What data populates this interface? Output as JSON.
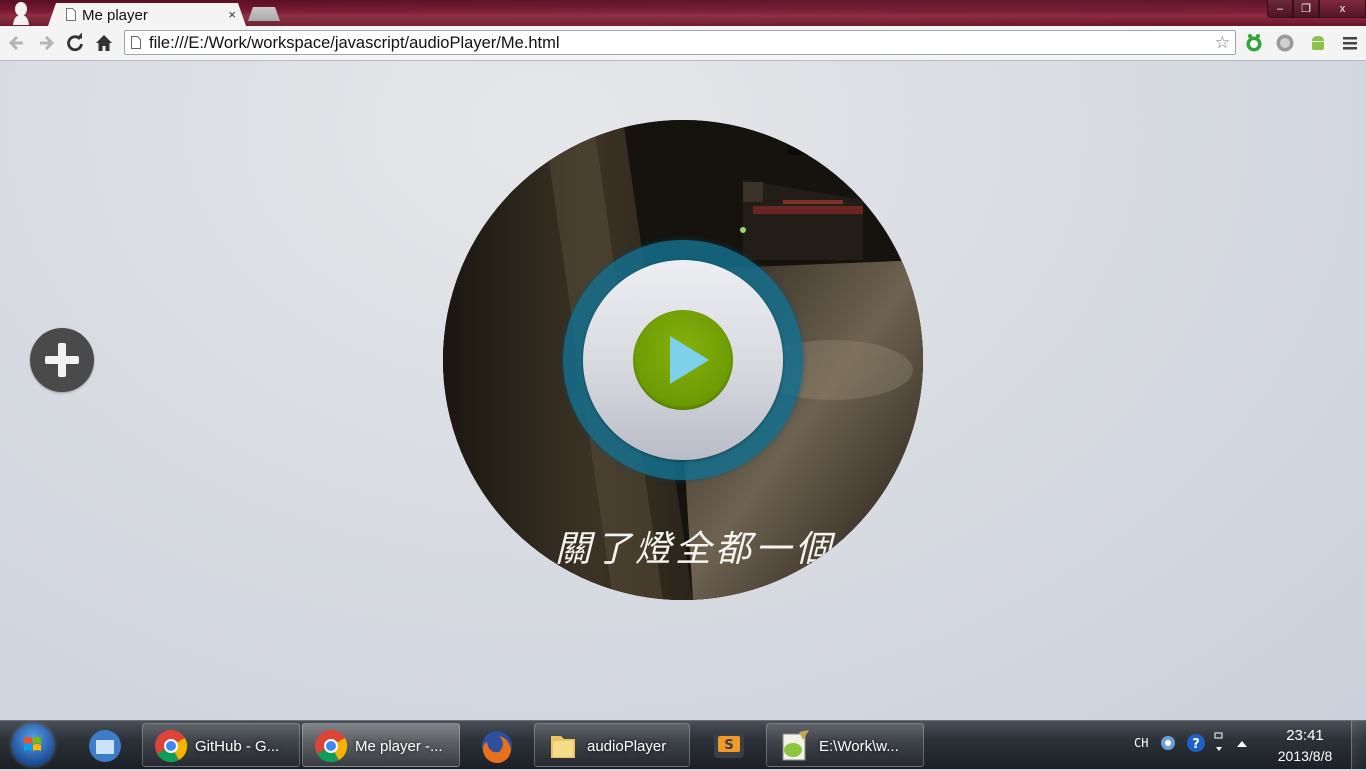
{
  "browser": {
    "tab_title": "Me player",
    "tab_close": "×",
    "url": "file:///E:/Work/workspace/javascript/audioPlayer/Me.html",
    "window_controls": {
      "minimize": "–",
      "maximize": "❐",
      "close": "x"
    }
  },
  "player": {
    "album_subtitle": "關了燈全都一個",
    "state": "paused",
    "colors": {
      "ring": "#146e8c",
      "play_button": "#6c9a03",
      "play_glyph": "#7fd0ea",
      "add_button": "#4a4a4a"
    }
  },
  "taskbar": {
    "items": [
      {
        "label": "",
        "icon": "explorer-libraries-icon"
      },
      {
        "label": "GitHub - G...",
        "icon": "chrome-icon"
      },
      {
        "label": "Me player -...",
        "icon": "chrome-icon"
      },
      {
        "label": "",
        "icon": "firefox-icon"
      },
      {
        "label": "audioPlayer",
        "icon": "folder-icon"
      },
      {
        "label": "",
        "icon": "sublime-text-icon"
      },
      {
        "label": "E:\\Work\\w...",
        "icon": "notepad-plus-plus-icon"
      }
    ],
    "tray": {
      "language": "CH",
      "time": "23:41",
      "date": "2013/8/8"
    }
  }
}
